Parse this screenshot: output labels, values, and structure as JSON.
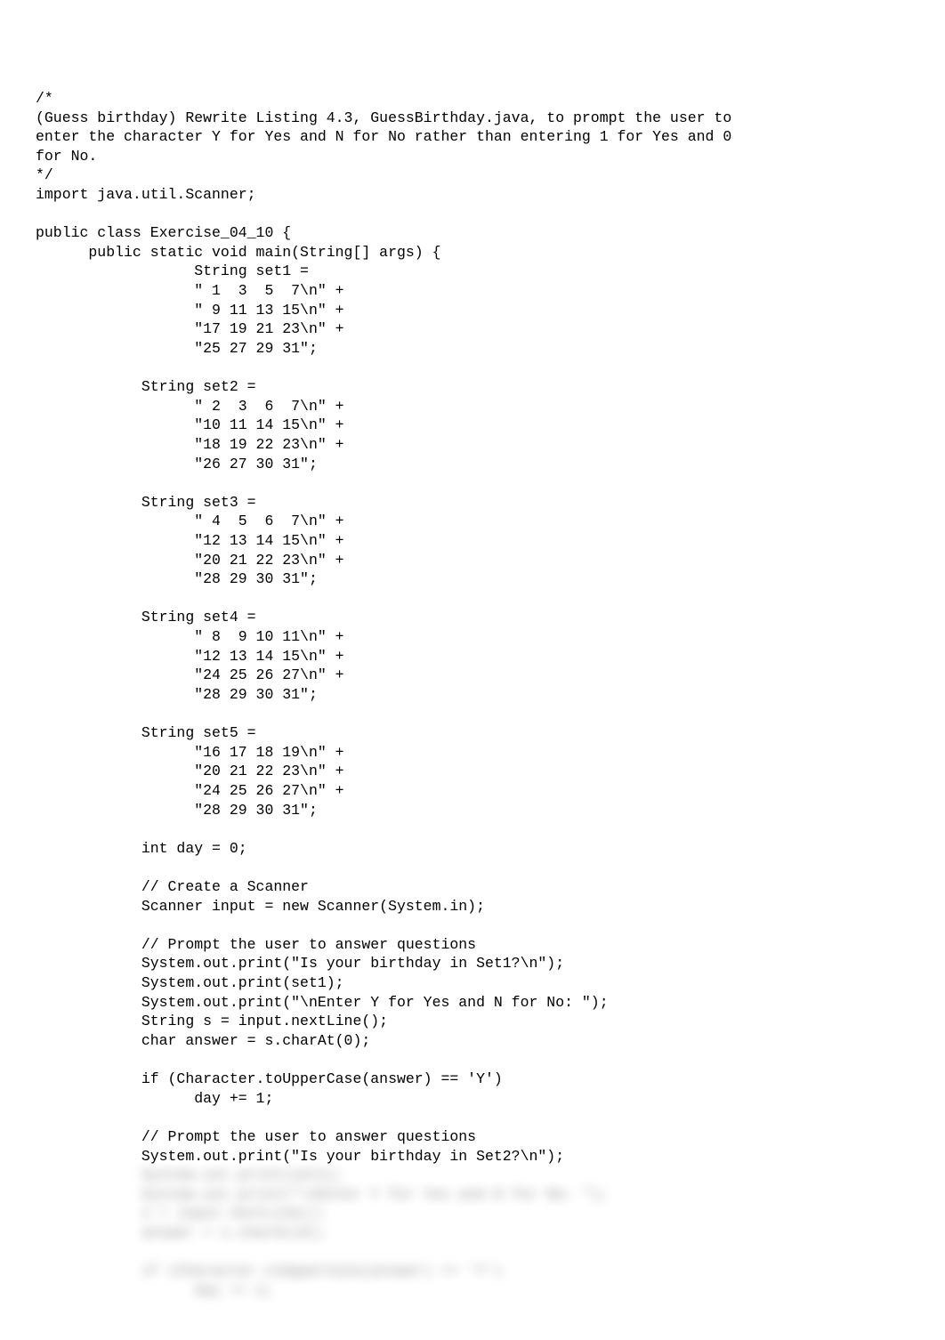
{
  "code": {
    "lines": [
      "/*",
      "(Guess birthday) Rewrite Listing 4.3, GuessBirthday.java, to prompt the user to",
      "enter the character Y for Yes and N for No rather than entering 1 for Yes and 0",
      "for No.",
      "*/",
      "import java.util.Scanner;",
      "",
      "public class Exercise_04_10 {",
      "      public static void main(String[] args) {",
      "                  String set1 =",
      "                  \" 1  3  5  7\\n\" +",
      "                  \" 9 11 13 15\\n\" +",
      "                  \"17 19 21 23\\n\" +",
      "                  \"25 27 29 31\";",
      "",
      "            String set2 =",
      "                  \" 2  3  6  7\\n\" +",
      "                  \"10 11 14 15\\n\" +",
      "                  \"18 19 22 23\\n\" +",
      "                  \"26 27 30 31\";",
      "",
      "            String set3 =",
      "                  \" 4  5  6  7\\n\" +",
      "                  \"12 13 14 15\\n\" +",
      "                  \"20 21 22 23\\n\" +",
      "                  \"28 29 30 31\";",
      "",
      "            String set4 =",
      "                  \" 8  9 10 11\\n\" +",
      "                  \"12 13 14 15\\n\" +",
      "                  \"24 25 26 27\\n\" +",
      "                  \"28 29 30 31\";",
      "",
      "            String set5 =",
      "                  \"16 17 18 19\\n\" +",
      "                  \"20 21 22 23\\n\" +",
      "                  \"24 25 26 27\\n\" +",
      "                  \"28 29 30 31\";",
      "",
      "            int day = 0;",
      "",
      "            // Create a Scanner",
      "            Scanner input = new Scanner(System.in);",
      "",
      "            // Prompt the user to answer questions",
      "            System.out.print(\"Is your birthday in Set1?\\n\");",
      "            System.out.print(set1);",
      "            System.out.print(\"\\nEnter Y for Yes and N for No: \");",
      "            String s = input.nextLine();",
      "            char answer = s.charAt(0);",
      "",
      "            if (Character.toUpperCase(answer) == 'Y')",
      "                  day += 1;",
      "",
      "            // Prompt the user to answer questions",
      "            System.out.print(\"Is your birthday in Set2?\\n\");"
    ],
    "blurred_lines": [
      "            System.out.print(set2);",
      "            System.out.print(\"\\nEnter Y for Yes and N for No: \");",
      "            s = input.nextLine();",
      "            answer = s.charAt(0);",
      "",
      "            if (Character.toUpperCase(answer) == 'Y')",
      "                  day += 2;"
    ]
  }
}
